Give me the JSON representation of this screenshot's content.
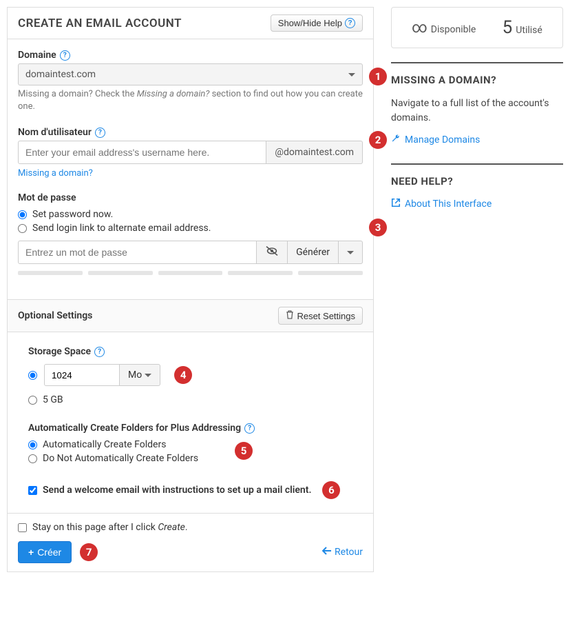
{
  "header": {
    "title": "CREATE AN EMAIL ACCOUNT",
    "toggle_help": "Show/Hide Help"
  },
  "domain": {
    "label": "Domaine",
    "selected": "domaintest.com",
    "hint_pre": "Missing a domain? Check the ",
    "hint_em": "Missing a domain?",
    "hint_post": " section to find out how you can create one."
  },
  "username": {
    "label": "Nom d'utilisateur",
    "placeholder": "Enter your email address's username here.",
    "suffix": "@domaintest.com",
    "missing_link": "Missing a domain?"
  },
  "password": {
    "label": "Mot de passe",
    "opt_now": "Set password now.",
    "opt_link": "Send login link to alternate email address.",
    "placeholder": "Entrez un mot de passe",
    "generate": "Générer"
  },
  "optional": {
    "title": "Optional Settings",
    "reset": "Reset Settings",
    "storage": {
      "label": "Storage Space",
      "value": "1024",
      "unit": "Mo",
      "alt": "5 GB"
    },
    "folders": {
      "label": "Automatically Create Folders for Plus Addressing",
      "opt_auto": "Automatically Create Folders",
      "opt_no": "Do Not Automatically Create Folders"
    },
    "welcome": "Send a welcome email with instructions to set up a mail client."
  },
  "footer": {
    "stay_pre": "Stay on this page after I click ",
    "stay_em": "Create",
    "create": "Créer",
    "back": "Retour"
  },
  "side": {
    "usage_avail_label": "Disponible",
    "usage_used_num": "5",
    "usage_used_label": "Utilisé",
    "missing_title": "MISSING A DOMAIN?",
    "missing_text": "Navigate to a full list of the account's domains.",
    "manage_link": "Manage Domains",
    "help_title": "NEED HELP?",
    "about_link": "About This Interface"
  },
  "markers": [
    "1",
    "2",
    "3",
    "4",
    "5",
    "6",
    "7"
  ]
}
